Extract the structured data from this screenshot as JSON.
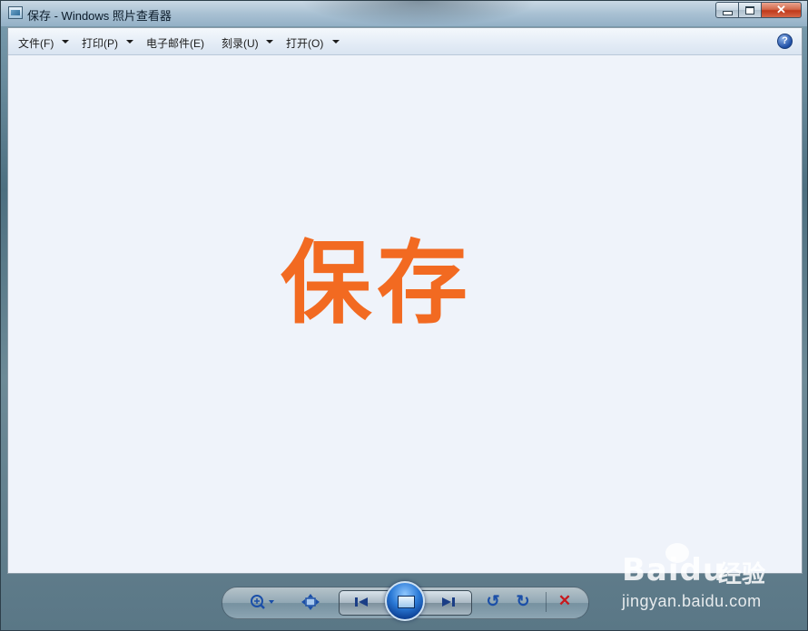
{
  "window": {
    "title": "保存 - Windows 照片查看器",
    "caption_buttons": [
      "minimize",
      "maximize",
      "close"
    ],
    "close_glyph": "✕"
  },
  "menubar": {
    "items": [
      {
        "label": "文件(F)",
        "has_dropdown": true
      },
      {
        "label": "打印(P)",
        "has_dropdown": true
      },
      {
        "label": "电子邮件(E)",
        "has_dropdown": false
      },
      {
        "label": "刻录(U)",
        "has_dropdown": true
      },
      {
        "label": "打开(O)",
        "has_dropdown": true
      }
    ],
    "help_glyph": "?"
  },
  "image": {
    "text": "保存",
    "text_color": "#f26a21",
    "background": "#eff3fa"
  },
  "controlbar": {
    "buttons": [
      "zoom-icon",
      "fit-to-window-icon",
      "previous-icon",
      "slideshow-icon",
      "next-icon",
      "rotate-counterclockwise-icon",
      "rotate-clockwise-icon",
      "delete-icon"
    ],
    "glyphs": {
      "rotate_ccw": "↺",
      "rotate_cw": "↻",
      "delete": "✕"
    }
  },
  "watermark": {
    "logo": "Baidu",
    "cn": "经验",
    "url": "jingyan.baidu.com"
  }
}
